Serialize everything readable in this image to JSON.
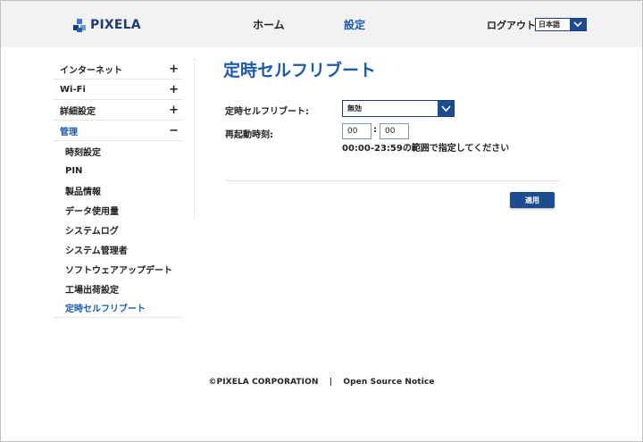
{
  "header": {
    "brand": "PIXELA",
    "nav_home": "ホーム",
    "nav_settings": "設定",
    "logout": "ログアウト",
    "language": "日本語"
  },
  "sidebar": {
    "groups": [
      {
        "label": "インターネット",
        "sign": "+"
      },
      {
        "label": "Wi-Fi",
        "sign": "+"
      },
      {
        "label": "詳細設定",
        "sign": "+"
      },
      {
        "label": "管理",
        "sign": "−"
      }
    ],
    "sub_items": [
      "時刻設定",
      "PIN",
      "製品情報",
      "データ使用量",
      "システムログ",
      "システム管理者",
      "ソフトウェアアップデート",
      "工場出荷設定",
      "定時セルフリブート"
    ]
  },
  "main": {
    "title": "定時セルフリブート",
    "reboot_label": "定時セルフリブート:",
    "reboot_value": "無効",
    "time_label": "再起動時刻:",
    "hour_value": "00",
    "minute_value": "00",
    "colon": ":",
    "hint": "00:00-23:59の範囲で指定してください",
    "apply_label": "適用"
  },
  "footer": {
    "copyright": "©PIXELA CORPORATION",
    "separator": "|",
    "link": "Open Source Notice"
  },
  "colors": {
    "accent": "#1b5cab",
    "header_bg": "#f2f2f2",
    "button_bg": "#1d4c8e"
  }
}
